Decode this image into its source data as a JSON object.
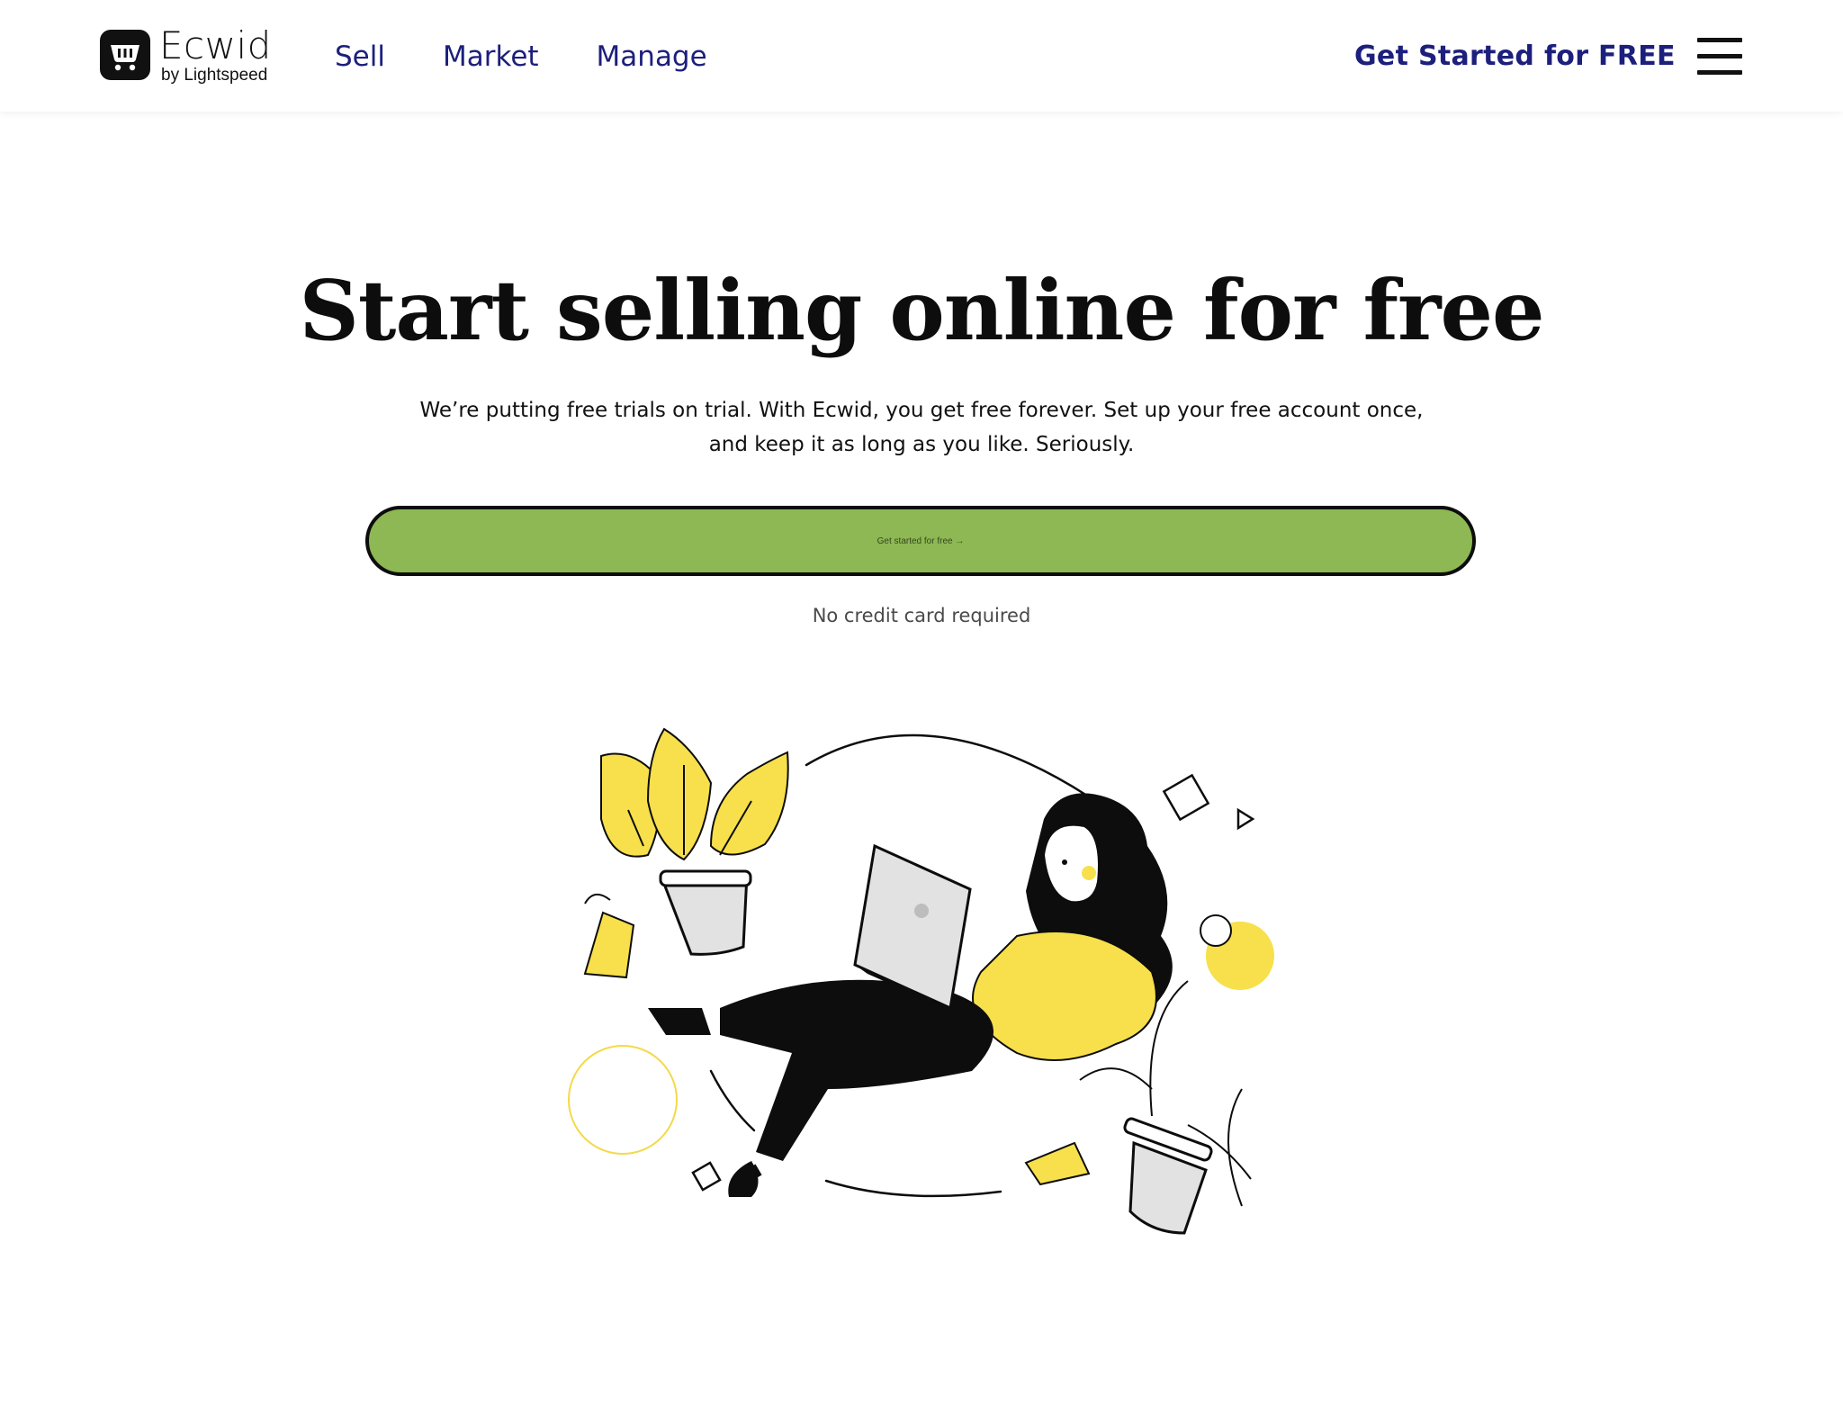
{
  "header": {
    "logo": {
      "word": "Ecwid",
      "sub": "by Lightspeed",
      "icon": "shopping-basket-icon"
    },
    "nav": [
      {
        "label": "Sell"
      },
      {
        "label": "Market"
      },
      {
        "label": "Manage"
      }
    ],
    "cta": "Get Started for FREE",
    "menu_icon": "hamburger-menu-icon"
  },
  "hero": {
    "title": "Start selling online for free",
    "subtitle_line1": "We’re putting free trials on trial. With Ecwid, you get free forever. Set up your free account once,",
    "subtitle_line2": "and keep it as long as you like. Seriously.",
    "cta_label": "Get started for free →",
    "note": "No credit card required"
  },
  "colors": {
    "nav_text": "#1c1f7c",
    "cta_fill": "#8db853",
    "accent_yellow": "#f7e04b",
    "ink": "#0d0d0d"
  }
}
